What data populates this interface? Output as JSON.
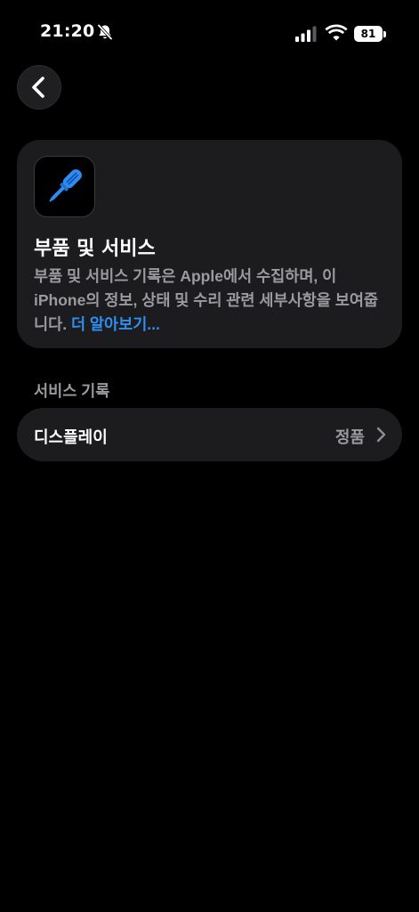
{
  "status_bar": {
    "time": "21:20",
    "battery_level": "81",
    "icons": [
      "bell-slash-icon",
      "cellular-signal-icon",
      "wifi-icon",
      "battery-icon"
    ]
  },
  "nav": {
    "back_icon": "chevron-left-icon"
  },
  "info_card": {
    "icon": "screwdriver-icon",
    "title": "부품 및 서비스",
    "description": "부품 및 서비스 기록은 Apple에서 수집하며, 이 iPhone의 정보, 상태 및 수리 관련 세부사항을 보여줍니다. ",
    "learn_more": "더 알아보기...",
    "accent_color": "#2E8FF0"
  },
  "service_history": {
    "header": "서비스 기록",
    "rows": [
      {
        "label": "디스플레이",
        "value": "정품",
        "icon": "chevron-right-icon"
      }
    ]
  }
}
